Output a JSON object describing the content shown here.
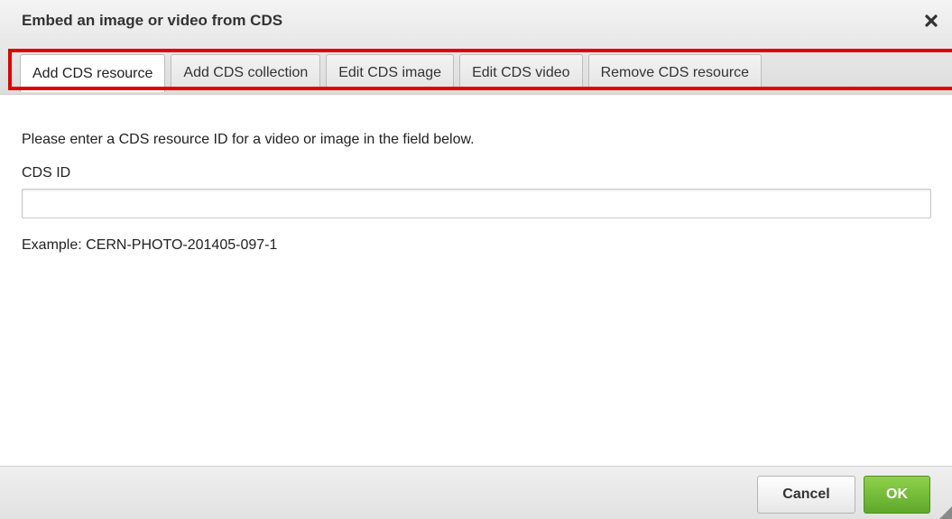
{
  "dialog": {
    "title": "Embed an image or video from CDS",
    "close_icon": "close-icon"
  },
  "tabs": [
    {
      "label": "Add CDS resource",
      "active": true
    },
    {
      "label": "Add CDS collection",
      "active": false
    },
    {
      "label": "Edit CDS image",
      "active": false
    },
    {
      "label": "Edit CDS video",
      "active": false
    },
    {
      "label": "Remove CDS resource",
      "active": false
    }
  ],
  "content": {
    "instruction": "Please enter a CDS resource ID for a video or image in the field below.",
    "field_label": "CDS ID",
    "field_value": "",
    "example": "Example: CERN-PHOTO-201405-097-1"
  },
  "footer": {
    "cancel_label": "Cancel",
    "ok_label": "OK"
  },
  "colors": {
    "highlight": "#e00000",
    "ok_button": "#6ab82f"
  }
}
